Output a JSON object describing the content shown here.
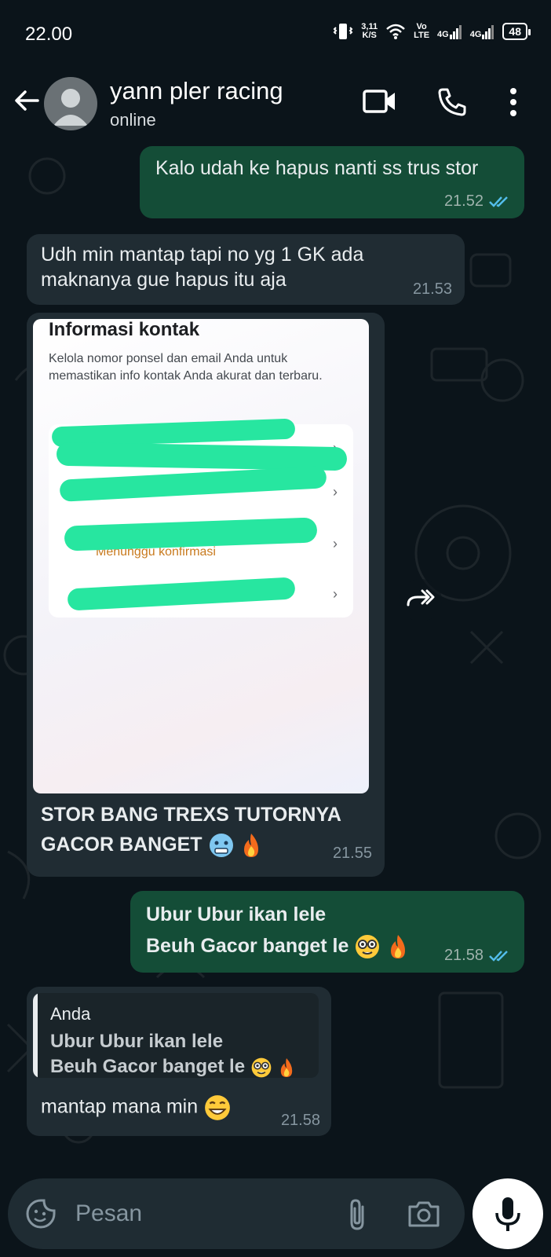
{
  "status_bar": {
    "time": "22.00",
    "speed_value": "3,11",
    "speed_unit": "K/S",
    "volte": "Vo\nLTE",
    "net1": "4G",
    "net2": "4G",
    "battery": "48"
  },
  "header": {
    "contact_name": "yann pler racing",
    "status": "online"
  },
  "messages": [
    {
      "dir": "out",
      "text": "Kalo udah ke hapus nanti ss trus stor",
      "time": "21.52"
    },
    {
      "dir": "in",
      "line1": "Udh min mantap tapi no yg 1 GK ada",
      "line2": "maknanya gue hapus itu aja",
      "time": "21.53"
    },
    {
      "dir": "in",
      "image": {
        "title": "Informasi kontak",
        "description": "Kelola nomor ponsel dan email Anda untuk memastikan info kontak Anda akurat dan terbaru.",
        "waiting_text": "Menunggu konfirmasi"
      },
      "line1": "STOR BANG TREXS TUTORNYA",
      "line2": "GACOR BANGET",
      "time": "21.55"
    },
    {
      "dir": "out",
      "line1": "Ubur Ubur ikan lele",
      "line2": "Beuh Gacor banget le",
      "time": "21.58"
    },
    {
      "dir": "in",
      "reply_name": "Anda",
      "reply_line1": "Ubur Ubur ikan lele",
      "reply_line2": "Beuh Gacor banget le",
      "text": "mantap mana min",
      "time": "21.58"
    }
  ],
  "input": {
    "placeholder": "Pesan"
  },
  "colors": {
    "background": "#0b141a",
    "outgoing_bubble": "#144d37",
    "incoming_bubble": "#202c33",
    "read_ticks": "#53bdeb",
    "censor_scribble": "#27e6a0"
  }
}
